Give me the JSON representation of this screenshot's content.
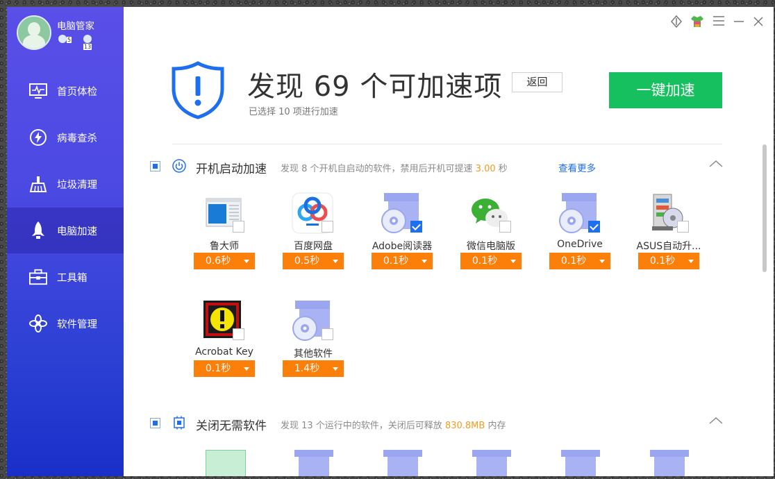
{
  "app": {
    "title": "电脑管家",
    "badges": [
      {
        "label": "5"
      },
      {
        "label": "13"
      }
    ]
  },
  "sidebar": {
    "items": [
      {
        "label": "首页体检",
        "icon": "monitor-icon"
      },
      {
        "label": "病毒查杀",
        "icon": "lightning-icon"
      },
      {
        "label": "垃圾清理",
        "icon": "broom-icon"
      },
      {
        "label": "电脑加速",
        "icon": "rocket-icon",
        "active": true
      },
      {
        "label": "工具箱",
        "icon": "toolbox-icon"
      },
      {
        "label": "软件管理",
        "icon": "apps-icon"
      }
    ]
  },
  "titlebar": {
    "buttons": [
      "feedback-icon",
      "skin-icon",
      "menu-icon",
      "minimize-icon",
      "close-icon"
    ]
  },
  "header": {
    "title": "发现 69 个可加速项",
    "subtitle": "已选择 10 项进行加速",
    "back_label": "返回",
    "primary_label": "一键加速"
  },
  "sections": [
    {
      "title": "开机启动加速",
      "desc_pre": "发现 8 个开机自启动的软件，禁用后开机可提速 ",
      "desc_value": "3.00",
      "desc_post": " 秒",
      "more_label": "查看更多",
      "collapse_glyph": "︿"
    },
    {
      "title": "关闭无需软件",
      "desc_pre": "发现 13 个运行中的软件，关闭后可释放 ",
      "desc_value": "830.8MB",
      "desc_post": " 内存",
      "collapse_glyph": "︿"
    }
  ],
  "startup_items": [
    {
      "name": "鲁大师",
      "time": "0.6秒",
      "checked": false,
      "icon": "window-app-icon"
    },
    {
      "name": "百度网盘",
      "time": "0.5秒",
      "checked": false,
      "icon": "baidu-netdisk-icon"
    },
    {
      "name": "Adobe阅读器",
      "time": "0.1秒",
      "checked": true,
      "icon": "generic-install-icon"
    },
    {
      "name": "微信电脑版",
      "time": "0.1秒",
      "checked": false,
      "icon": "wechat-icon"
    },
    {
      "name": "OneDrive",
      "time": "0.1秒",
      "checked": true,
      "icon": "generic-install-icon"
    },
    {
      "name": "ASUS自动升...",
      "time": "0.1秒",
      "checked": false,
      "icon": "asus-setup-icon"
    },
    {
      "name": "Acrobat Key",
      "time": "0.1秒",
      "checked": false,
      "icon": "alert-app-icon"
    },
    {
      "name": "其他软件",
      "time": "1.4秒",
      "checked": false,
      "icon": "generic-install-icon"
    }
  ],
  "colors": {
    "accent": "#1e6ef0",
    "primary_button": "#16c05f",
    "time_select": "#fb7f08",
    "highlight": "#f49b1c"
  }
}
